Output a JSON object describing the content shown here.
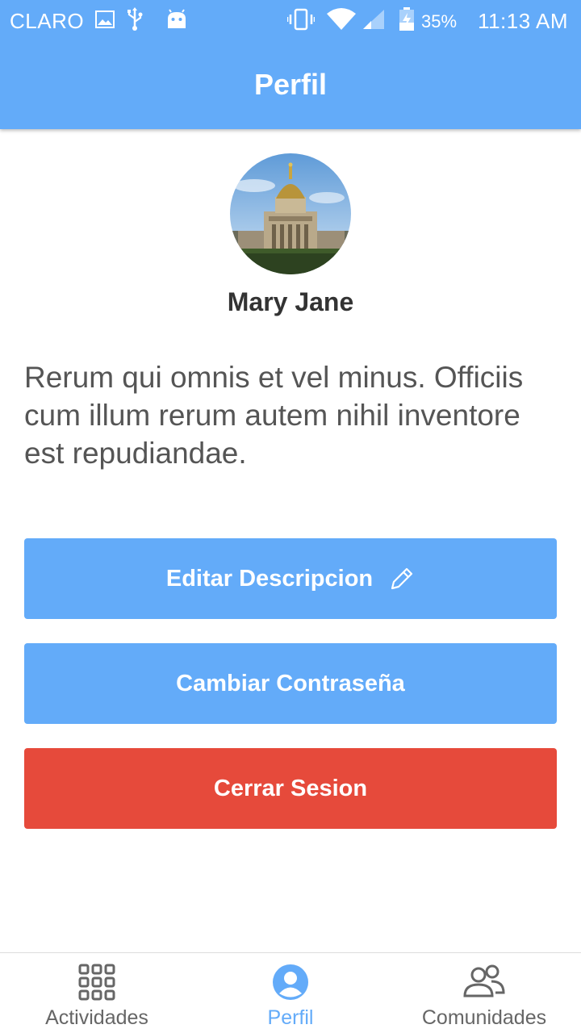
{
  "status_bar": {
    "carrier": "CLARO",
    "battery_percent": "35%",
    "time": "11:13 AM"
  },
  "app_bar": {
    "title": "Perfil"
  },
  "profile": {
    "name": "Mary Jane",
    "description": "Rerum qui omnis et vel minus. Officiis cum illum rerum autem nihil inventore est repudiandae."
  },
  "buttons": {
    "edit_description": "Editar Descripcion",
    "change_password": "Cambiar Contraseña",
    "logout": "Cerrar Sesion"
  },
  "bottom_nav": {
    "items": [
      {
        "label": "Actividades",
        "icon": "grid-icon",
        "active": false
      },
      {
        "label": "Perfil",
        "icon": "user-circle-icon",
        "active": true
      },
      {
        "label": "Comunidades",
        "icon": "people-icon",
        "active": false
      }
    ]
  },
  "colors": {
    "primary": "#63abf9",
    "danger": "#e64a3b",
    "text_dark": "#333333",
    "text_body": "#555555"
  }
}
